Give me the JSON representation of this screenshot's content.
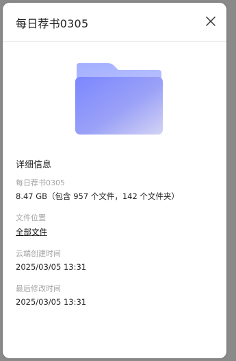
{
  "dialog": {
    "title": "每日荐书0305",
    "close_icon": "close-icon"
  },
  "folder": {
    "icon": "folder-icon",
    "colors": {
      "back": "#98a6ff",
      "front_start": "#7d88ff",
      "front_end": "#c7c9f6"
    }
  },
  "details": {
    "section_title": "详细信息",
    "name_label": "每日荐书0305",
    "size_text": "8.47 GB（包含 957 个文件，142 个文件夹）",
    "location_label": "文件位置",
    "location_link": "全部文件",
    "created_label": "云端创建时间",
    "created_value": "2025/03/05 13:31",
    "modified_label": "最后修改时间",
    "modified_value": "2025/03/05 13:31"
  }
}
